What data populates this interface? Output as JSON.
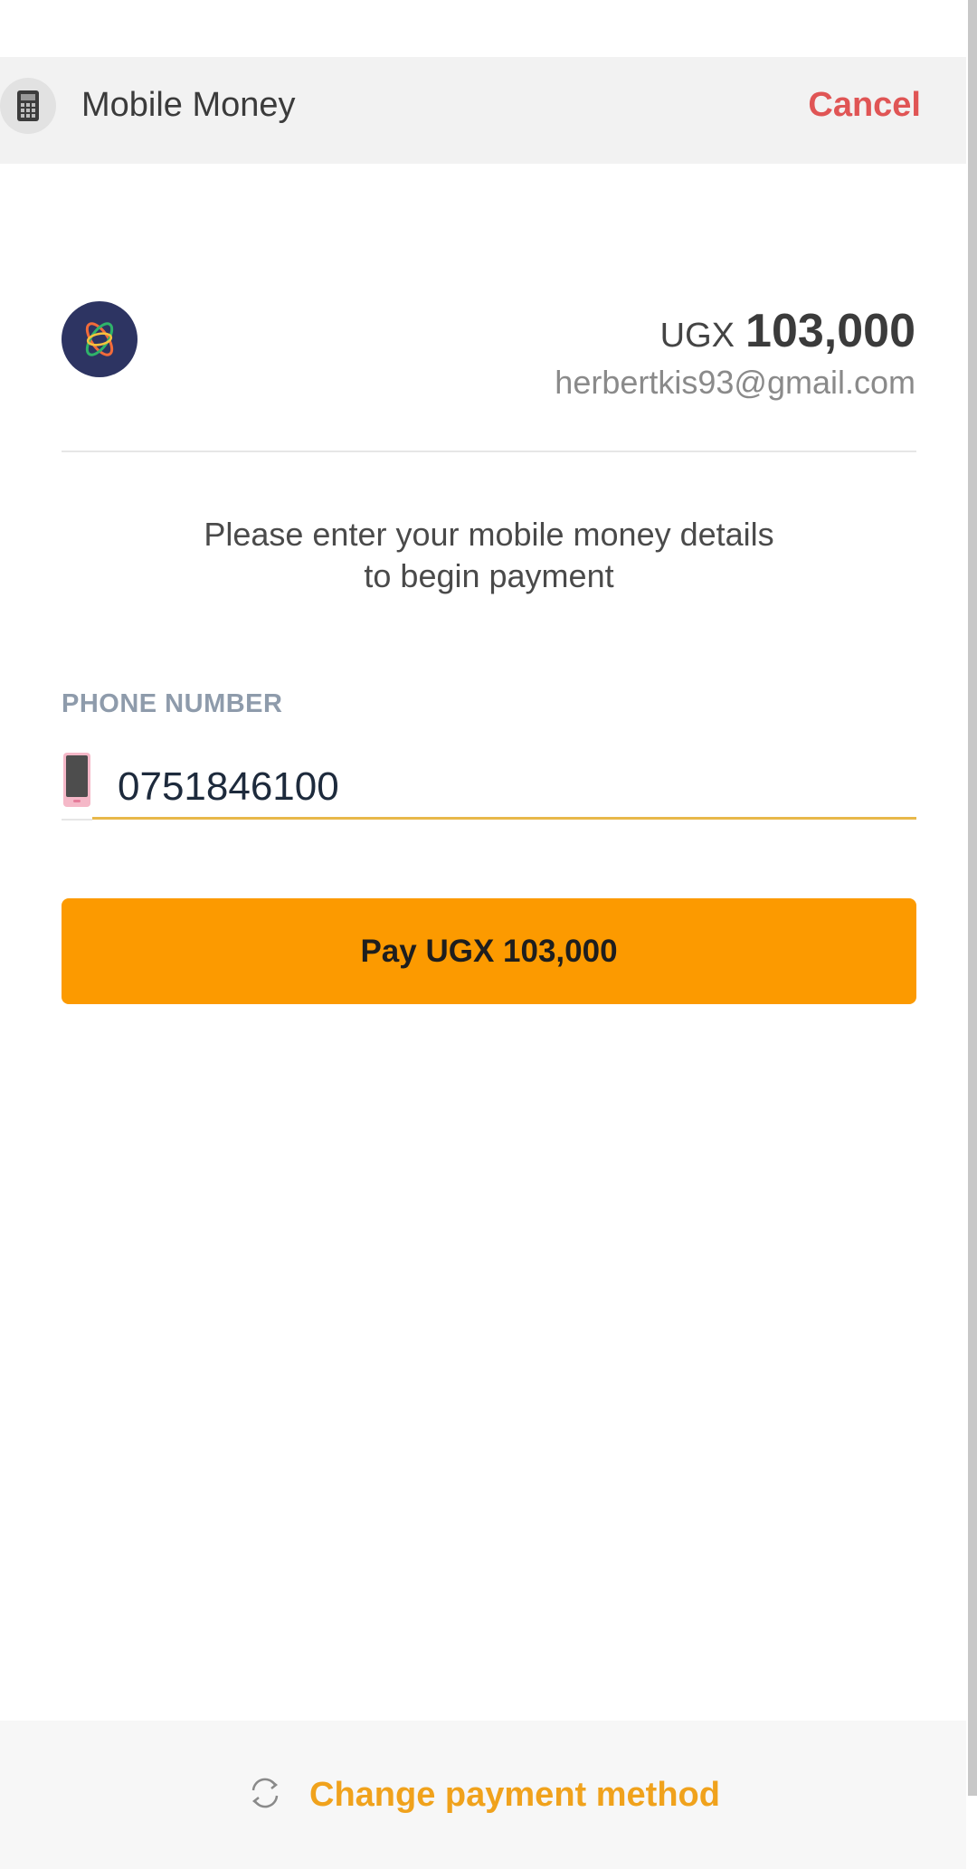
{
  "header": {
    "icon": "calculator-icon",
    "title": "Mobile Money",
    "cancel_label": "Cancel"
  },
  "merchant": {
    "logo": "orbit-logo-icon",
    "currency": "UGX",
    "amount": "103,000",
    "email": "herbertkis93@gmail.com"
  },
  "instructions": {
    "line1": "Please enter your mobile money details",
    "line2": "to begin payment"
  },
  "phone": {
    "label": "PHONE NUMBER",
    "value": "0751846100",
    "icon": "mobile-phone-icon"
  },
  "pay_button": {
    "label": "Pay UGX 103,000"
  },
  "footer": {
    "change_method_label": "Change payment method",
    "icon": "refresh-icon"
  },
  "colors": {
    "accent": "#fc9a00",
    "cancel": "#e05555",
    "link": "#f0a21c",
    "input_underline": "#e8b84a"
  }
}
